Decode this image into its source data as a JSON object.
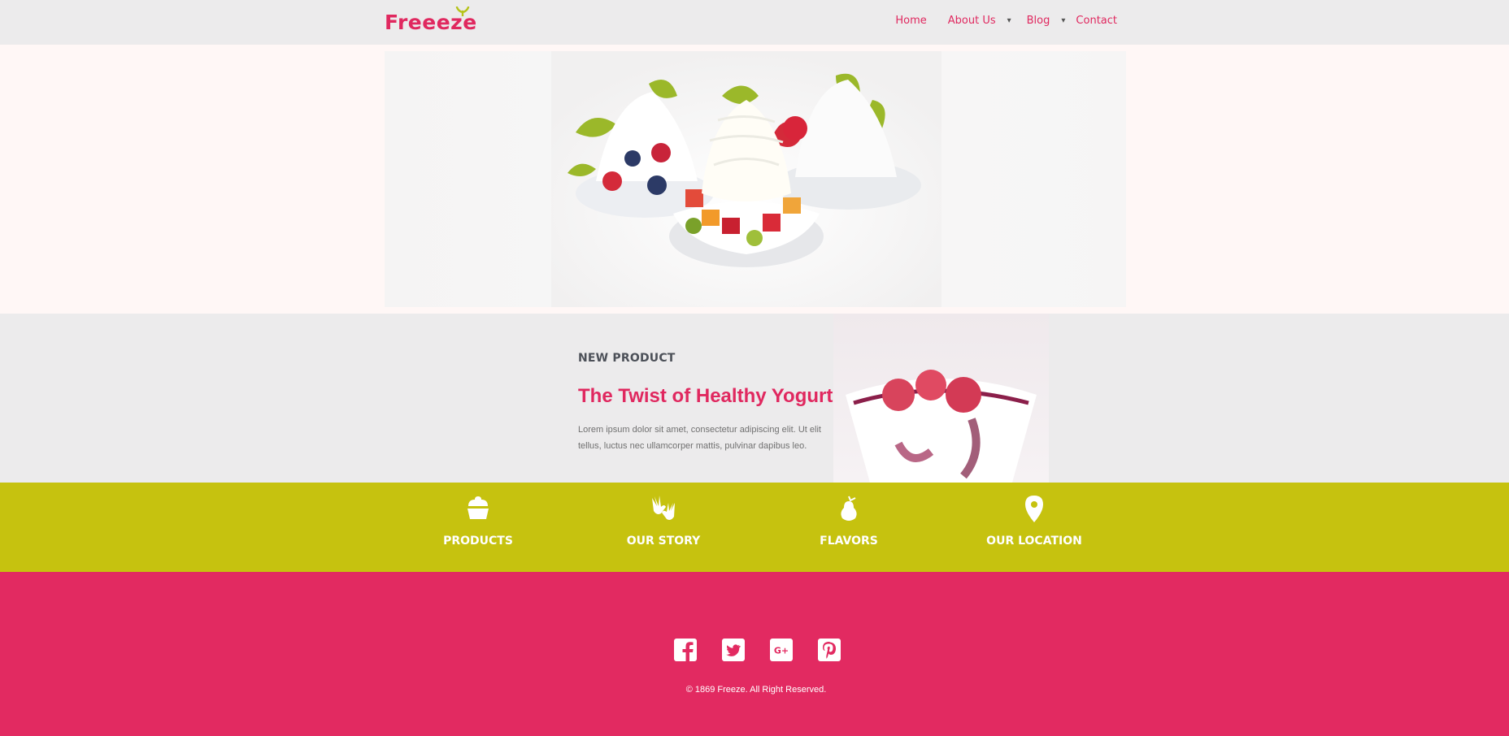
{
  "header": {
    "logo_text": "Freeeze",
    "nav": [
      {
        "label": "Home"
      },
      {
        "label": "About Us",
        "has_dropdown": true
      },
      {
        "label": "Blog",
        "has_dropdown": true
      },
      {
        "label": "Contact"
      }
    ],
    "caret": "▾"
  },
  "product": {
    "kicker": "NEW PRODUCT",
    "title": "The Twist of Healthy Yogurt",
    "description": "Lorem ipsum dolor sit amet, consectetur adipiscing elit. Ut elit tellus, luctus nec ullamcorper mattis, pulvinar dapibus leo."
  },
  "features": [
    {
      "label": "PRODUCTS",
      "icon": "cupcake-icon"
    },
    {
      "label": "OUR STORY",
      "icon": "hands-icon"
    },
    {
      "label": "FLAVORS",
      "icon": "pear-icon"
    },
    {
      "label": "OUR LOCATION",
      "icon": "map-pin-icon"
    }
  ],
  "footer": {
    "social": [
      "facebook-icon",
      "twitter-icon",
      "google-plus-icon",
      "pinterest-icon"
    ],
    "copyright": "© 1869 Freeze. All Right Reserved."
  },
  "colors": {
    "brand_pink": "#e0285f",
    "lime": "#c6c20f",
    "header_bg": "#ecebec",
    "footer_bg": "#e22a61"
  }
}
